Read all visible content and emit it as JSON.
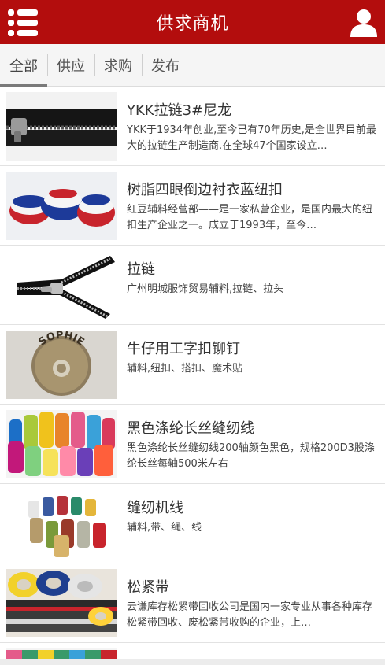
{
  "header": {
    "title": "供求商机",
    "menu_icon": "list-menu-icon",
    "user_icon": "user-icon"
  },
  "tabs": [
    {
      "label": "全部",
      "active": true
    },
    {
      "label": "供应",
      "active": false
    },
    {
      "label": "求购",
      "active": false
    },
    {
      "label": "发布",
      "active": false
    }
  ],
  "items": [
    {
      "name": "YKK拉链3#尼龙",
      "desc": "YKK于1934年创业,至今已有70年历史,是全世界目前最大的拉链生产制造商.在全球47个国家设立…",
      "image": "black-zipper"
    },
    {
      "name": "树脂四眼倒边衬衣蓝纽扣",
      "desc": "红豆辅料经营部——是一家私营企业，是国内最大的纽扣生产企业之一。成立于1993年，至今…",
      "image": "blue-red-white-buttons"
    },
    {
      "name": "拉链",
      "desc": "广州明城服饰贸易辅料,拉链、拉头",
      "image": "open-zipper"
    },
    {
      "name": "牛仔用工字扣铆钉",
      "desc": "辅料,纽扣、搭扣、魔术贴",
      "image": "sophie-jeans-button",
      "image_text": "SOPHIE"
    },
    {
      "name": "黑色涤纶长丝缝纫线",
      "desc": "黑色涤纶长丝缝纫线200轴颜色黑色，规格200D3股涤纶长丝每轴500米左右",
      "image": "colorful-thread-cones"
    },
    {
      "name": "缝纫机线",
      "desc": "辅料,带、绳、线",
      "image": "thread-spools"
    },
    {
      "name": "松紧带",
      "desc": "云谦库存松紧带回收公司是国内一家专业从事各种库存松紧带回收、废松紧带收购的企业，上…",
      "image": "elastic-band-rolls"
    },
    {
      "name": "",
      "desc": "",
      "image": "partial-next-item"
    }
  ],
  "colors": {
    "header_bg": "#b30d0d",
    "header_text": "#ffffff",
    "tab_underline": "#7a7a7a"
  }
}
